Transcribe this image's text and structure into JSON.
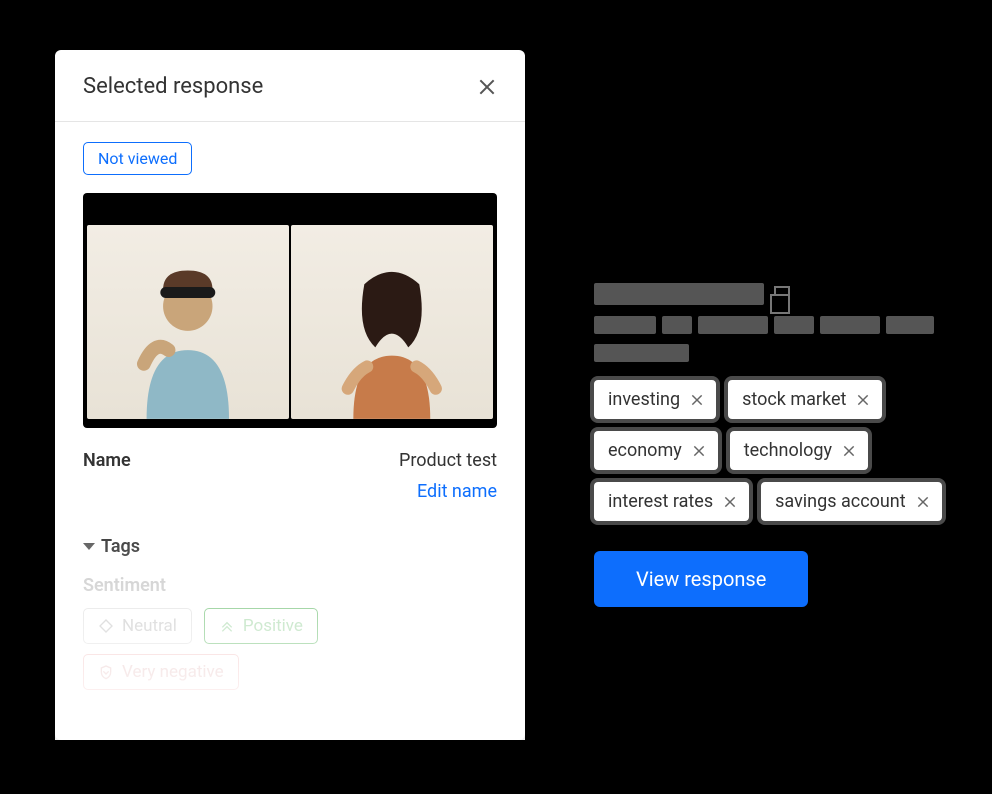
{
  "panel": {
    "title": "Selected response",
    "status_badge": "Not viewed",
    "name_label": "Name",
    "name_value": "Product test",
    "edit_link": "Edit name",
    "tags_title": "Tags",
    "sentiment_label": "Sentiment",
    "sentiment_neutral": "Neutral",
    "sentiment_positive": "Positive",
    "sentiment_very_negative": "Very negative"
  },
  "right": {
    "view_button": "View response",
    "topics": [
      "investing",
      "stock market",
      "economy",
      "technology",
      "interest rates",
      "savings account"
    ]
  }
}
